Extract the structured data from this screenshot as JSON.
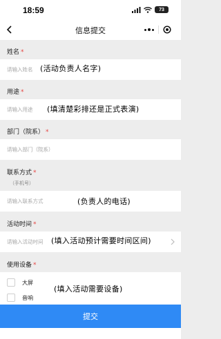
{
  "status_bar": {
    "time": "18:59",
    "battery": "73",
    "icons": [
      "signal-icon",
      "wifi-icon",
      "battery-icon"
    ]
  },
  "nav": {
    "title": "信息提交",
    "back_icon": "back-icon",
    "more_icon": "more-icon",
    "close_icon": "target-icon"
  },
  "form": {
    "required_mark": "*",
    "name": {
      "label": "姓名",
      "placeholder": "请输入姓名",
      "annotation": "(活动负责人名字)"
    },
    "purpose": {
      "label": "用途",
      "placeholder": "请输入用途",
      "annotation": "(填清楚彩排还是正式表演)"
    },
    "department": {
      "label": "部门（院系）",
      "placeholder": "请输入部门（院系）"
    },
    "contact": {
      "label": "联系方式",
      "sublabel": "（手机号）",
      "placeholder": "请输入联系方式",
      "annotation": "(负责人的电话)"
    },
    "time": {
      "label": "活动时间",
      "placeholder": "请输入活动时间",
      "annotation": "(填入活动预计需要时间区间)"
    },
    "devices": {
      "label": "使用设备",
      "items": [
        "大屏",
        "音响"
      ],
      "annotation": "(填入活动需要设备)"
    }
  },
  "submit": {
    "label": "提交"
  },
  "colors": {
    "background": "#ededed",
    "submit_blue": "#2f8af5",
    "required_red": "#e64340"
  }
}
